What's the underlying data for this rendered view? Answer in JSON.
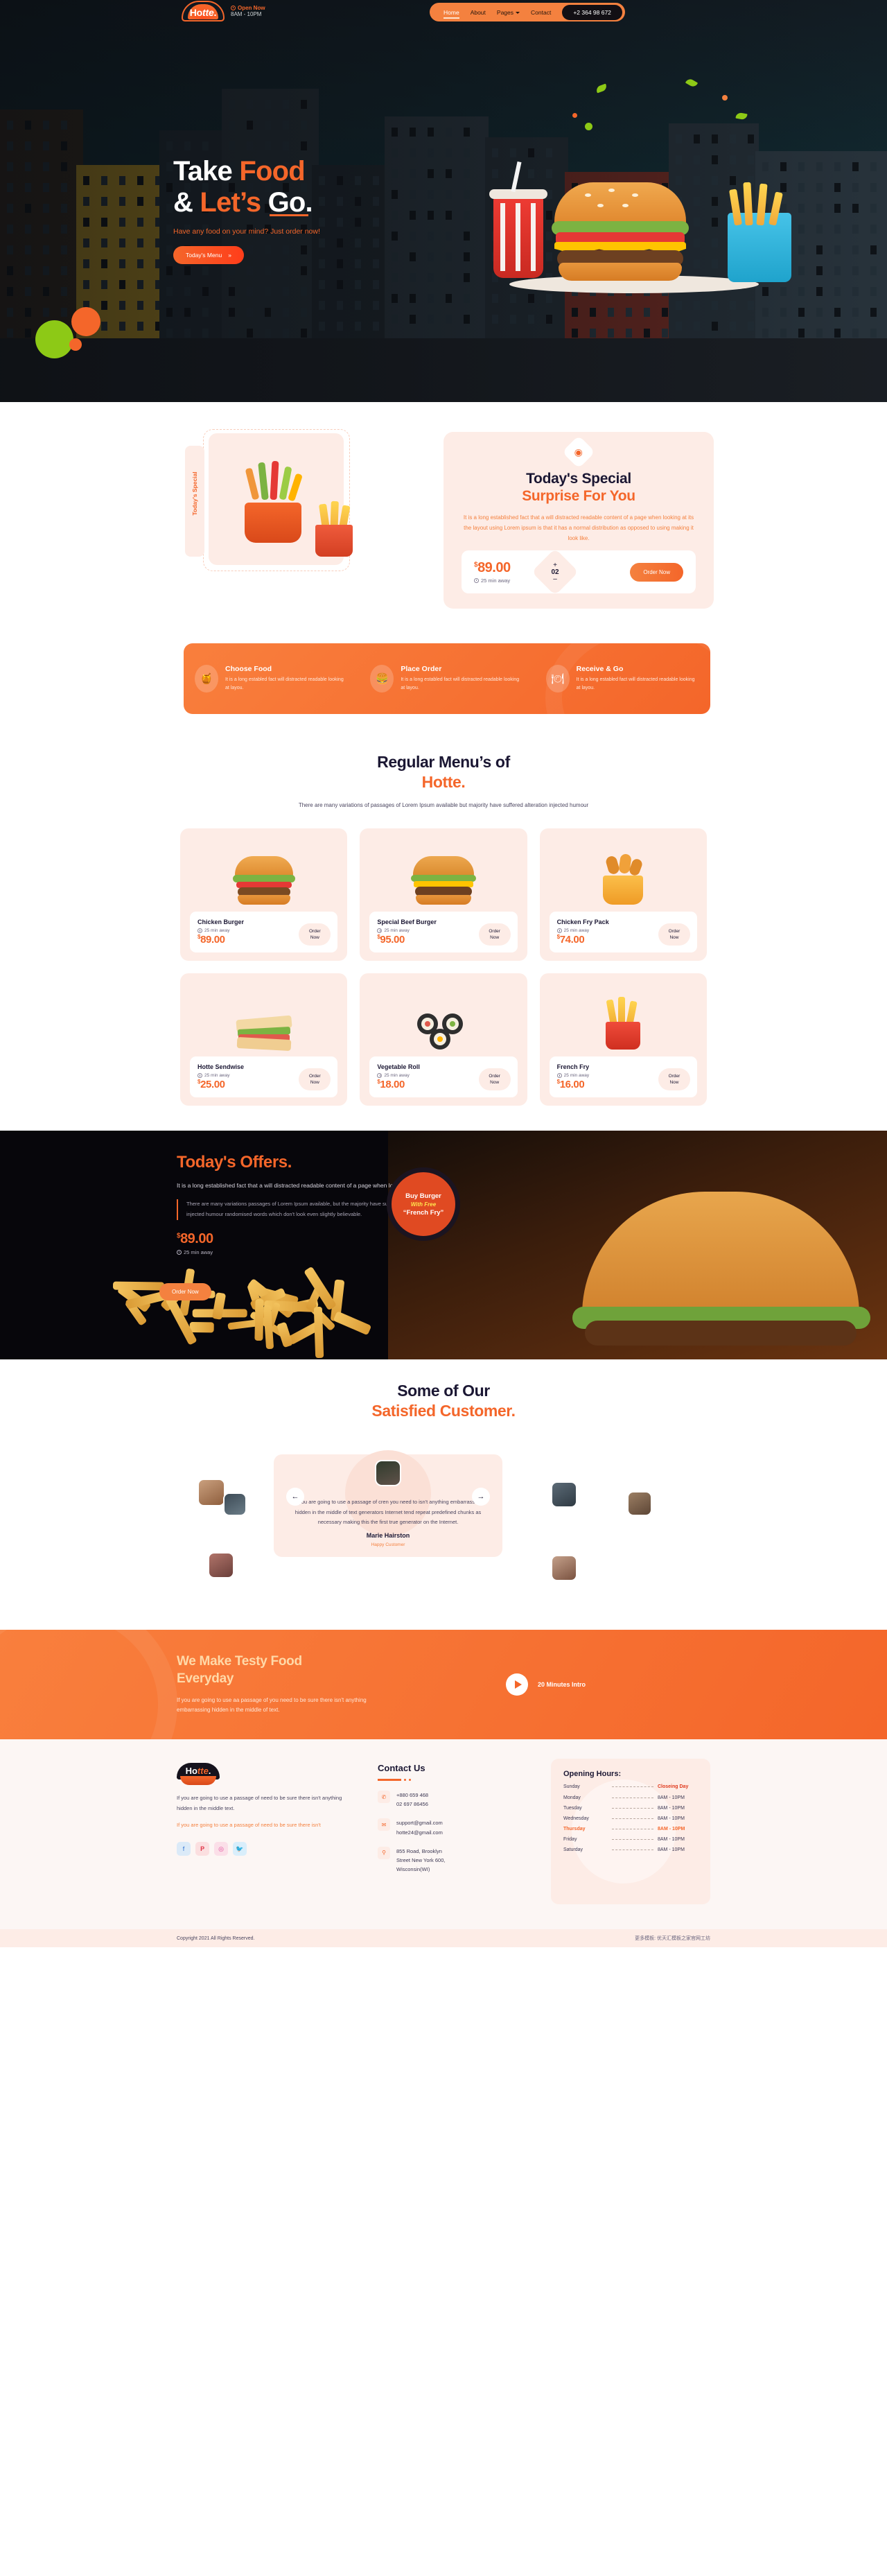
{
  "header": {
    "logo": {
      "pre": "Ho",
      "mid": "tte",
      "dot": "."
    },
    "open_now": "Open Now",
    "hours": "8AM - 10PM",
    "nav": [
      {
        "label": "Home",
        "active": true,
        "caret": false
      },
      {
        "label": "About",
        "active": false,
        "caret": false
      },
      {
        "label": "Pages",
        "active": false,
        "caret": true
      },
      {
        "label": "Contact",
        "active": false,
        "caret": false
      }
    ],
    "phone": "+2 364 98 672"
  },
  "hero": {
    "line1_a": "Take ",
    "line1_b": "Food",
    "line2_a": "& ",
    "line2_b": "Let’s ",
    "line2_c": "Go.",
    "subtitle_a": "Have any food on your mind? ",
    "subtitle_b": "Just order now!",
    "cta": "Today's Menu",
    "cta_arrow": "»"
  },
  "special": {
    "ribbon": "Today's Special",
    "icon": "◉",
    "title": "Today's Special",
    "subtitle": "Surprise For You",
    "paragraph_a": "It is a long established fact that a will distracted readable content of a page when looking at its the layout using Lorem ipsum is that it has a normal distribution ",
    "paragraph_b": "as opposed to using making it look like.",
    "currency": "$",
    "price": "89.00",
    "time": "25 min away",
    "qty_plus": "+",
    "qty_value": "02",
    "qty_minus": "–",
    "order": "Order Now"
  },
  "steps": [
    {
      "icon": "🍯",
      "title": "Choose Food",
      "desc": "It is a long establed fact will distracted readable looking at layou."
    },
    {
      "icon": "🍔",
      "title": "Place Order",
      "desc": "It is a long establed fact will distracted readable looking at layou."
    },
    {
      "icon": "🍽",
      "title": "Receive & Go",
      "desc": "It is a long establed fact will distracted readable looking at layou."
    }
  ],
  "menu": {
    "title_a": "Regular Menu’s of",
    "title_b": "Hotte.",
    "paragraph": "There are many variations of passages of Lorem Ipsum available but majority have suffered alteration injected humour",
    "order_line1": "Order",
    "order_line2": "Now",
    "currency": "$",
    "items": [
      {
        "name": "Chicken Burger",
        "time": "25 min away",
        "price": "89.00",
        "kind": "burger-chicken"
      },
      {
        "name": "Special Beef Burger",
        "time": "25 min away",
        "price": "95.00",
        "kind": "burger-beef"
      },
      {
        "name": "Chicken Fry Pack",
        "time": "25 min away",
        "price": "74.00",
        "kind": "chicken-fry"
      },
      {
        "name": "Hotte Sendwise",
        "time": "25 min away",
        "price": "25.00",
        "kind": "sandwich"
      },
      {
        "name": "Vegetable Roll",
        "time": "25 min away",
        "price": "18.00",
        "kind": "roll"
      },
      {
        "name": "French Fry",
        "time": "25 min away",
        "price": "16.00",
        "kind": "fries"
      }
    ]
  },
  "offers": {
    "title_a": "Today's ",
    "title_b": "Offers.",
    "paragraph": "It is a long established fact that a will distracted readable content of a page when looking the layout",
    "quote": "There are many variations passages of Lorem Ipsum available, but the majority have suffered alteration in form, by injected humour randomised words which don't look even slightly believable.",
    "currency": "$",
    "price": "89.00",
    "time": "25 min away",
    "order": "Order Now",
    "badge_line1": "Buy Burger",
    "badge_line2": "With Free",
    "badge_line3": "“French Fry”"
  },
  "testimonials": {
    "title_a": "Some of Our",
    "title_b": "Satisfied ",
    "title_c": "Customer.",
    "prev": "←",
    "next": "→",
    "quote": "If you are going to use a passage of cren you need to isn't anything embarrassing hidden in the middle of text generators Internet tend repeat predefined chunks as necessary making this the first true generator on the Internet.",
    "name": "Marie Hairston",
    "role": "Happy Customer"
  },
  "cta": {
    "title_a": "We Make Testy ",
    "title_b": "Food",
    "title_c": "Everyday",
    "paragraph": "If you are going to use aa passage of you need to be sure there isn't anything embarrassing hidden in the middle of text.",
    "video_label": "20 Minutes Intro"
  },
  "footer": {
    "logo": {
      "pre": "Ho",
      "mid": "tte",
      "dot": "."
    },
    "about": "If you are going to use a passage of need to be sure there isn't anything hidden in the middle text.",
    "about_alt": "If you are going to use a passage of need to be sure there isn't",
    "socials": [
      {
        "name": "facebook-icon",
        "glyph": "f",
        "bg": "#dbeaf8",
        "color": "#2d6fd0"
      },
      {
        "name": "pinterest-icon",
        "glyph": "𝐏",
        "bg": "#fbdfe0",
        "color": "#e0384a"
      },
      {
        "name": "dribbble-icon",
        "glyph": "◎",
        "bg": "#fbdfe8",
        "color": "#e0489a"
      },
      {
        "name": "twitter-icon",
        "glyph": "🐦",
        "bg": "#d9eefb",
        "color": "#2aa9e0"
      }
    ],
    "contact_title": "Contact Us",
    "contact": [
      {
        "icon": "phone-icon",
        "glyph": "✆",
        "lines": [
          "+880 659 468",
          "02 697 86456"
        ]
      },
      {
        "icon": "mail-icon",
        "glyph": "✉",
        "lines": [
          "support@gmail.com",
          "hotte24@gmail.com"
        ]
      },
      {
        "icon": "pin-icon",
        "glyph": "⚲",
        "lines": [
          "855 Road, Brooklyn",
          "Street New York 600,",
          "Wisconsin(WI)"
        ]
      }
    ],
    "hours_title": "Opening Hours:",
    "hours": [
      {
        "day": "Sunday",
        "value": "Closeing Day",
        "state": "closed"
      },
      {
        "day": "Monday",
        "value": "8AM - 10PM",
        "state": "open"
      },
      {
        "day": "Tuesday",
        "value": "8AM - 10PM",
        "state": "open"
      },
      {
        "day": "Wednesday",
        "value": "8AM - 10PM",
        "state": "open"
      },
      {
        "day": "Thursday",
        "value": "8AM - 10PM",
        "state": "today"
      },
      {
        "day": "Friday",
        "value": "8AM - 10PM",
        "state": "open"
      },
      {
        "day": "Saturday",
        "value": "8AM - 10PM",
        "state": "open"
      }
    ],
    "copyright": "Copyright 2021 All Rights Reserved.",
    "credit": "更多模板: 优天汇模板之家官网工坊"
  },
  "colors": {
    "accent": "#f4662a",
    "accent_light": "#f4813f",
    "dark": "#1b1733",
    "cream": "#fdece6",
    "green": "#8dc916"
  }
}
